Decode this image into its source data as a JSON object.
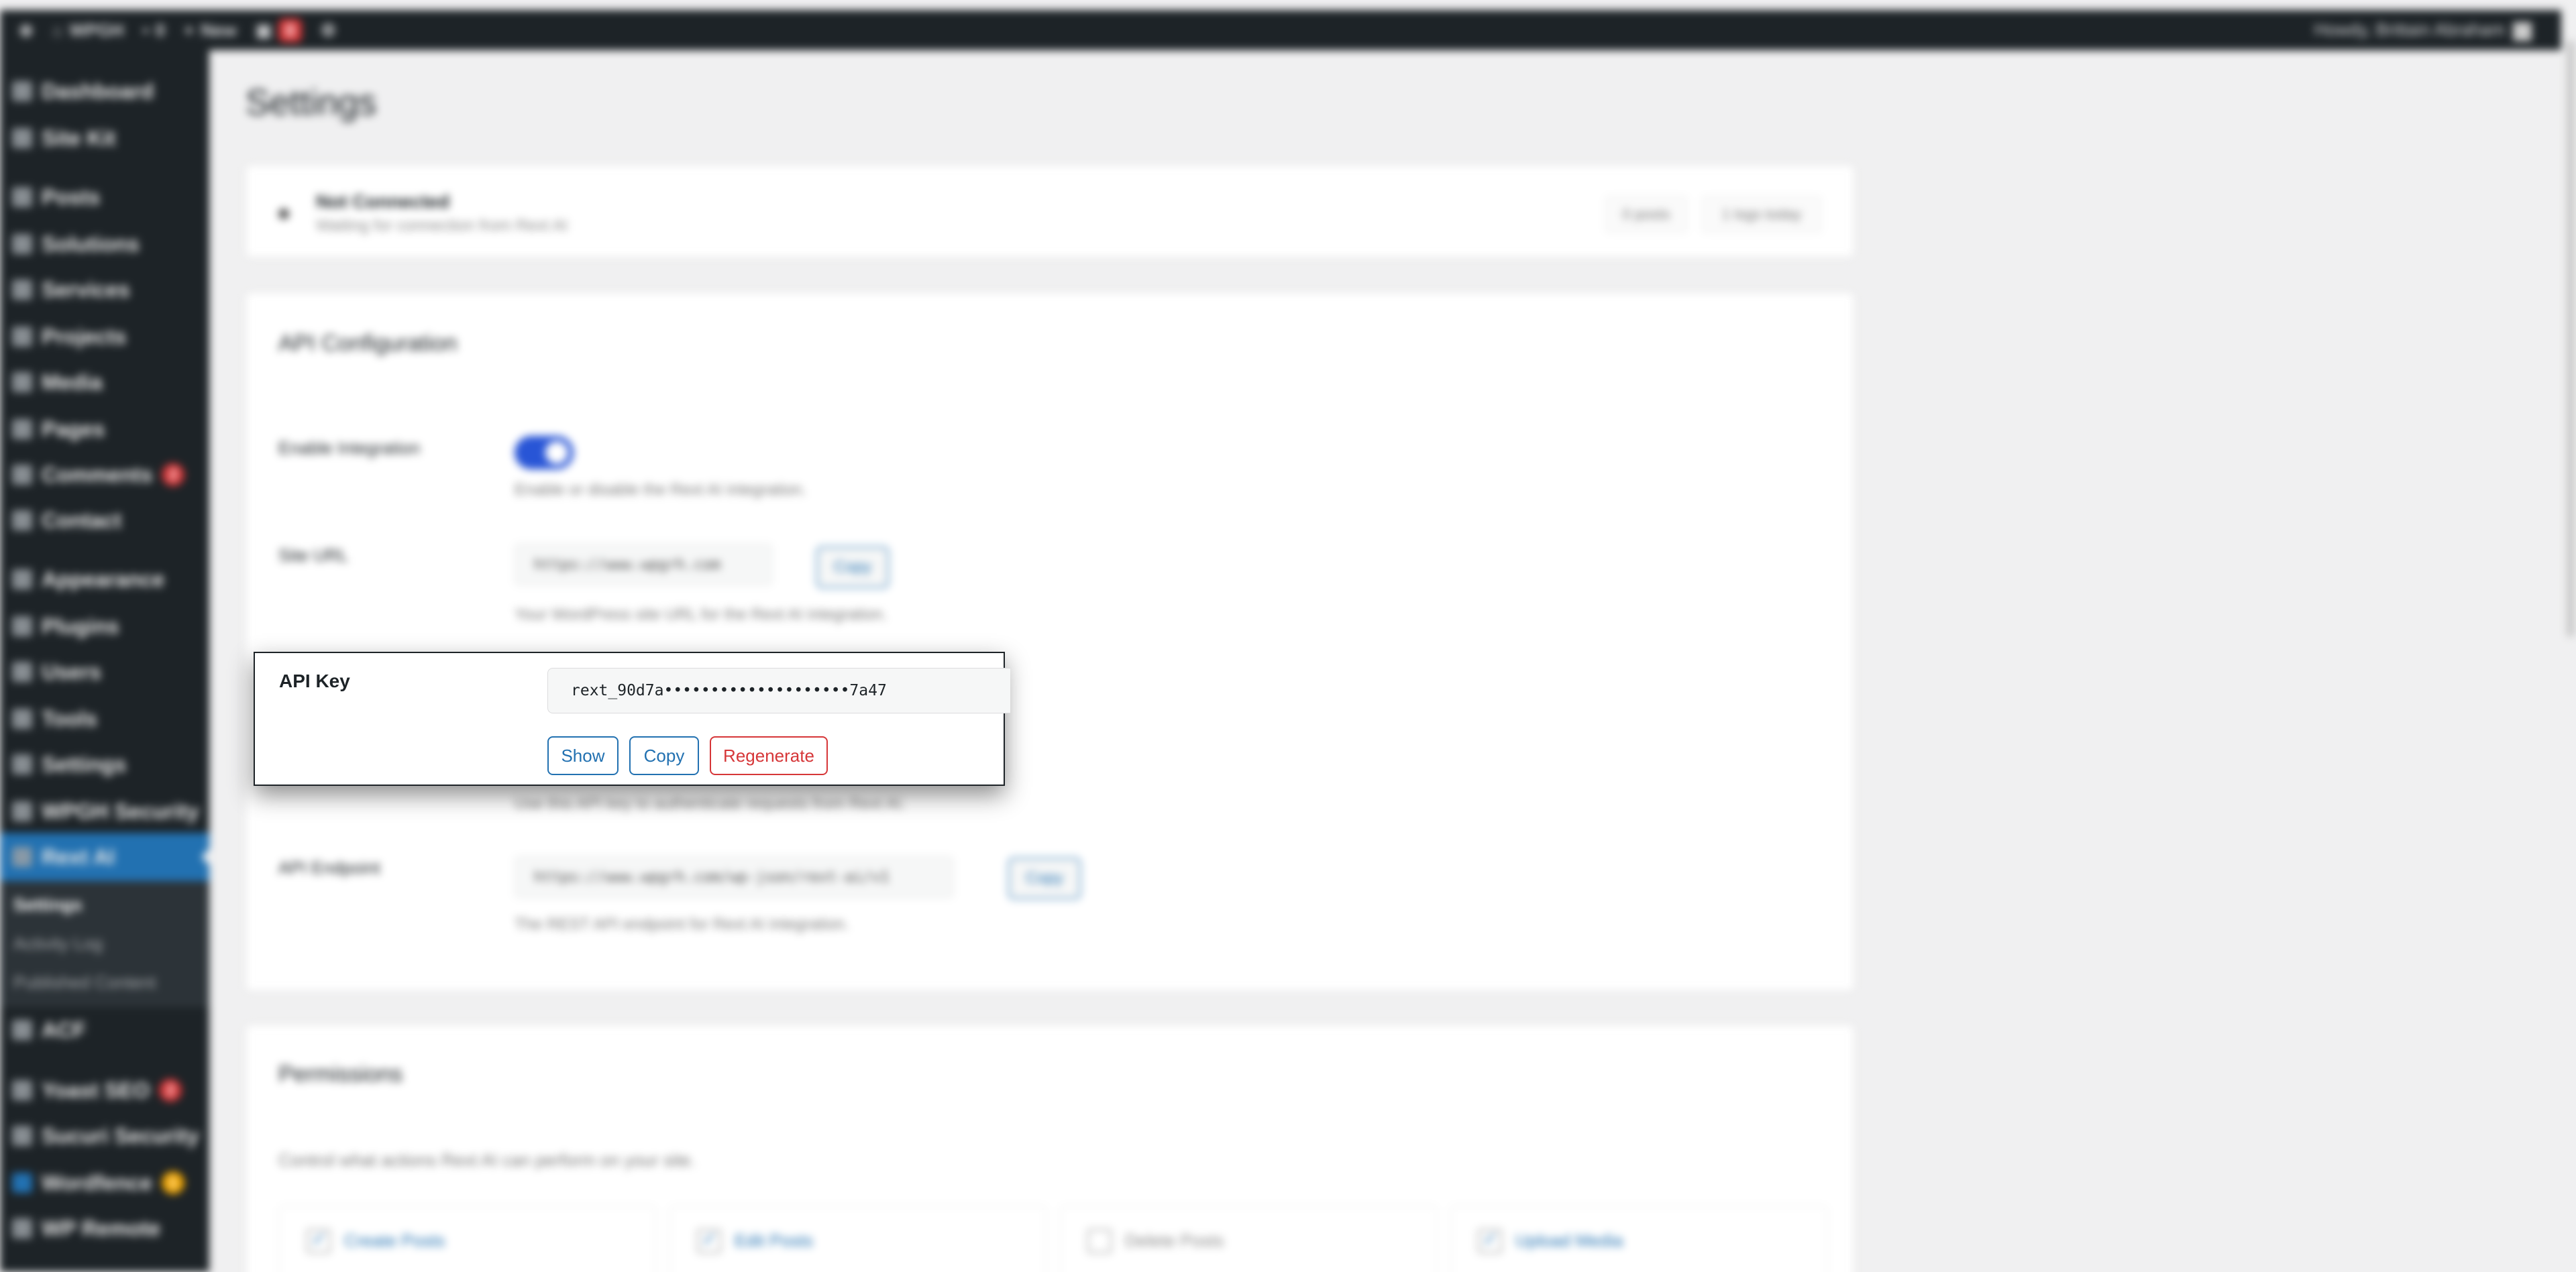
{
  "adminbar": {
    "site": "WPGH",
    "comments": "0",
    "new": "New",
    "updates": "0",
    "howdy": "Howdy, Brittain Abraham"
  },
  "sidebar": {
    "items": [
      {
        "label": "Dashboard",
        "icon": "dashboard-icon"
      },
      {
        "label": "Site Kit",
        "icon": "google-icon"
      },
      {
        "label": "Posts",
        "icon": "pin-icon"
      },
      {
        "label": "Solutions",
        "icon": "gear-icon"
      },
      {
        "label": "Services",
        "icon": "pin-icon"
      },
      {
        "label": "Projects",
        "icon": "folder-icon"
      },
      {
        "label": "Media",
        "icon": "media-icon"
      },
      {
        "label": "Pages",
        "icon": "page-icon"
      },
      {
        "label": "Comments",
        "icon": "comment-icon",
        "count": "2"
      },
      {
        "label": "Contact",
        "icon": "mail-icon"
      },
      {
        "label": "Appearance",
        "icon": "brush-icon"
      },
      {
        "label": "Plugins",
        "icon": "plug-icon"
      },
      {
        "label": "Users",
        "icon": "user-icon"
      },
      {
        "label": "Tools",
        "icon": "wrench-icon"
      },
      {
        "label": "Settings",
        "icon": "settings-icon"
      },
      {
        "label": "WPGH Security",
        "icon": "shield-icon"
      },
      {
        "label": "Rext AI",
        "icon": "home-icon"
      },
      {
        "label": "ACF",
        "icon": "grid-icon"
      },
      {
        "label": "Yoast SEO",
        "icon": "yoast-icon",
        "count": "2"
      },
      {
        "label": "Sucuri Security",
        "icon": "shield-icon"
      },
      {
        "label": "Wordfence",
        "icon": "wordfence-icon",
        "count": "1"
      },
      {
        "label": "WP Remote",
        "icon": "remote-icon"
      }
    ],
    "submenu": [
      "Settings",
      "Activity Log",
      "Published Content"
    ]
  },
  "page": {
    "title": "Settings"
  },
  "status": {
    "title": "Not Connected",
    "subtitle": "Waiting for connection from Rext AI",
    "pill1": "0 posts",
    "pill2": "1 logs today"
  },
  "api": {
    "heading": "API Configuration",
    "enable_label": "Enable Integration",
    "enable_hint": "Enable or disable the Rext AI integration.",
    "site_url_label": "Site URL",
    "site_url_value": "https://www.wpgrh.com",
    "site_url_copy": "Copy",
    "site_url_hint": "Your WordPress site URL for the Rext AI integration.",
    "api_key_hint": "Use this API key to authenticate requests from Rext AI.",
    "endpoint_label": "API Endpoint",
    "endpoint_value": "https://www.wpgrh.com/wp-json/rext-ai/v1",
    "endpoint_copy": "Copy",
    "endpoint_hint": "The REST API endpoint for Rext AI integration."
  },
  "permissions": {
    "heading": "Permissions",
    "hint": "Control what actions Rext AI can perform on your site.",
    "items": [
      {
        "label": "Create Posts",
        "checked": true
      },
      {
        "label": "Edit Posts",
        "checked": true
      },
      {
        "label": "Delete Posts",
        "checked": false
      },
      {
        "label": "Upload Media",
        "checked": true
      }
    ]
  },
  "popup": {
    "label": "API Key",
    "value": "rext_90d7a••••••••••••••••••••7a47",
    "show": "Show",
    "copy": "Copy",
    "regenerate": "Regenerate"
  },
  "colors": {
    "accent": "#2271b1",
    "danger": "#d63638",
    "admin_dark": "#1d2327",
    "toggle_on": "#2855d6"
  }
}
